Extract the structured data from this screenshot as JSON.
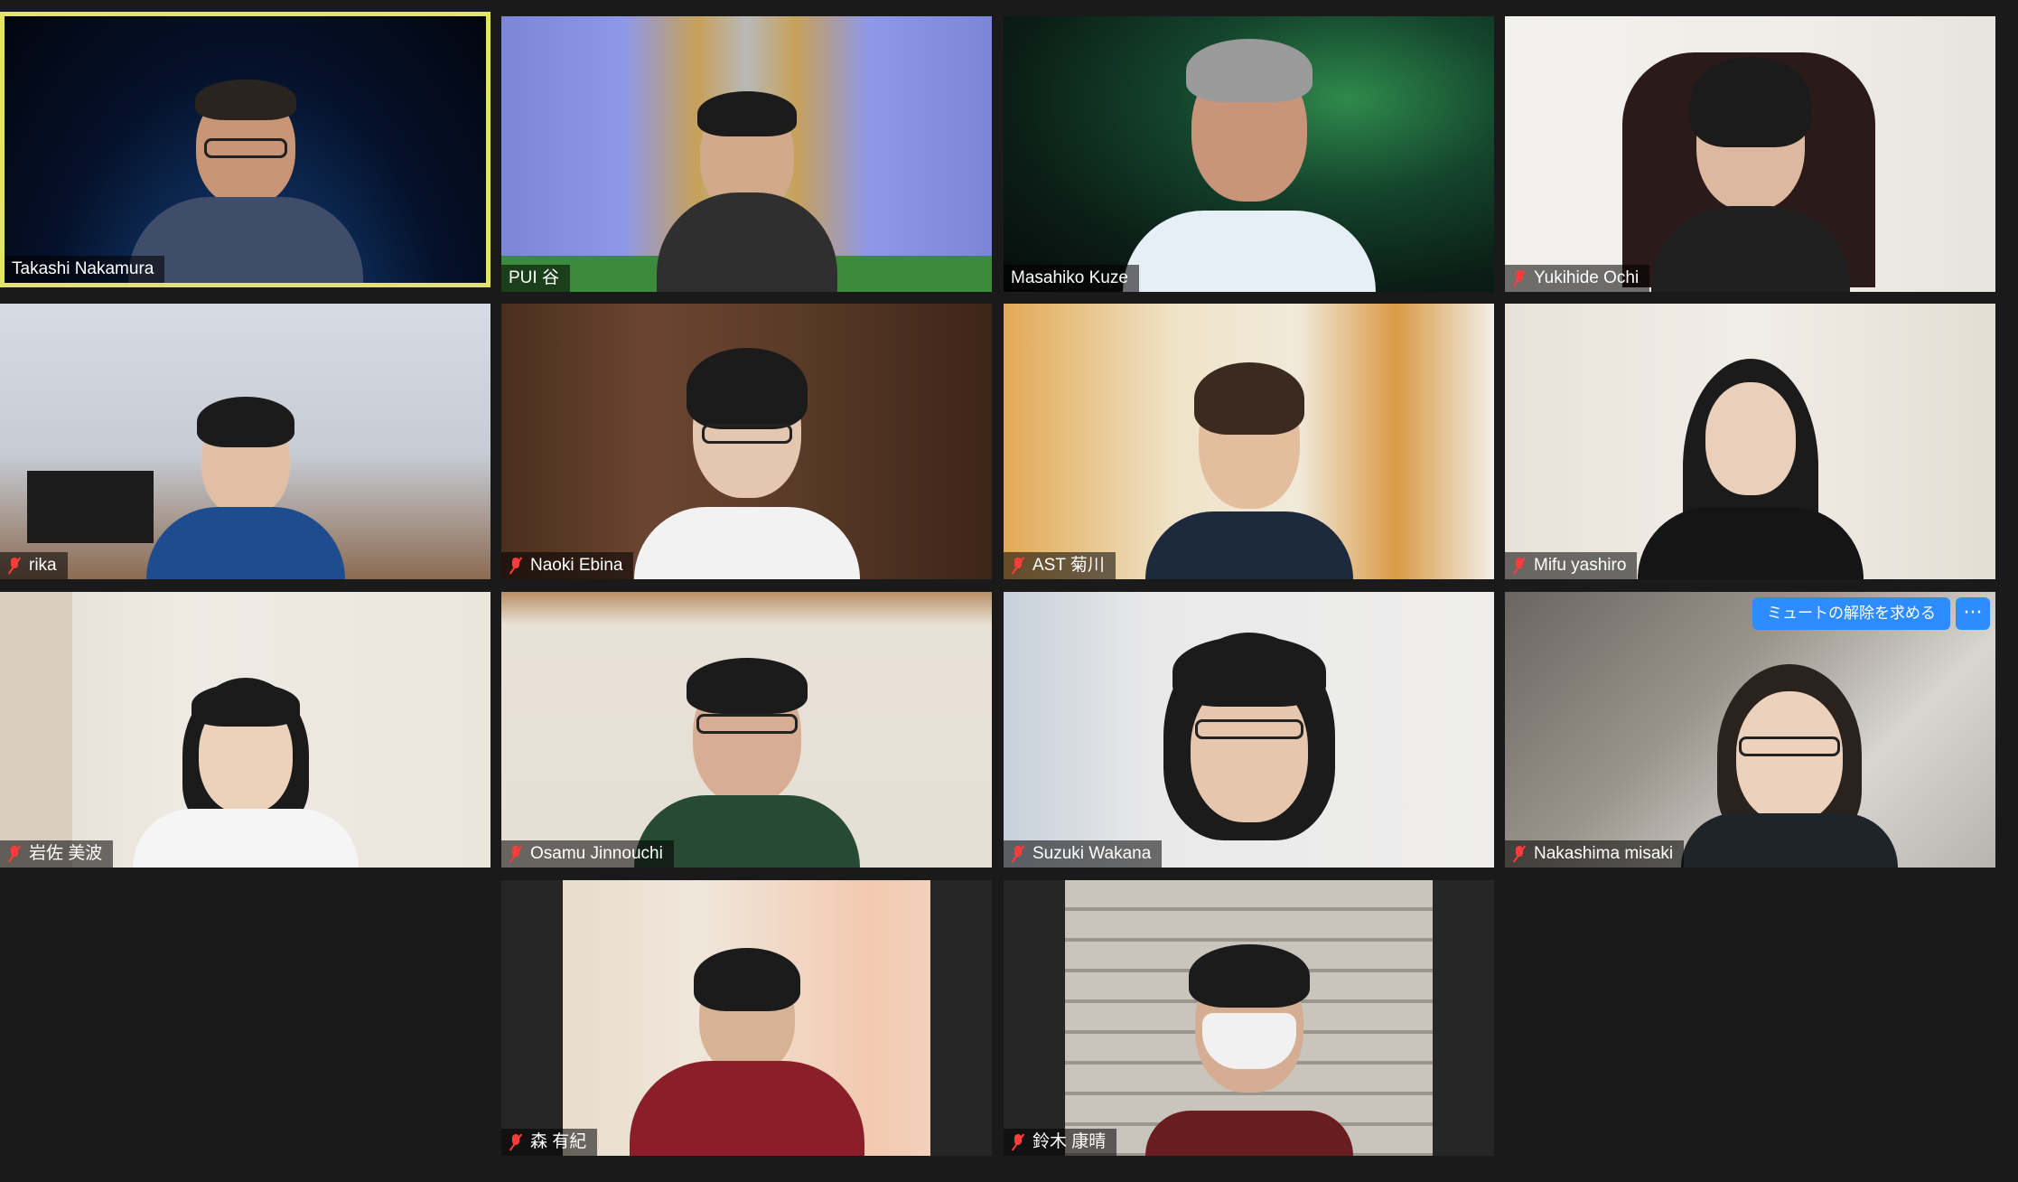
{
  "app": {
    "view": "gallery"
  },
  "unmute_request": {
    "button_label": "ミュートの解除を求める",
    "more_label": "···"
  },
  "participants": [
    {
      "name": "Takashi Nakamura",
      "muted": false,
      "active_speaker": true,
      "background": "earth-space"
    },
    {
      "name": "PUI 谷",
      "muted": false,
      "active_speaker": false,
      "background": "particle-detector"
    },
    {
      "name": "Masahiko Kuze",
      "muted": false,
      "active_speaker": false,
      "background": "aurora"
    },
    {
      "name": "Yukihide Ochi",
      "muted": true,
      "active_speaker": false,
      "background": "room"
    },
    {
      "name": "rika",
      "muted": true,
      "active_speaker": false,
      "background": "room"
    },
    {
      "name": "Naoki Ebina",
      "muted": true,
      "active_speaker": false,
      "background": "room"
    },
    {
      "name": "AST 菊川",
      "muted": true,
      "active_speaker": false,
      "background": "room"
    },
    {
      "name": "Mifu yashiro",
      "muted": true,
      "active_speaker": false,
      "background": "room"
    },
    {
      "name": "岩佐 美波",
      "muted": true,
      "active_speaker": false,
      "background": "room"
    },
    {
      "name": "Osamu Jinnouchi",
      "muted": true,
      "active_speaker": false,
      "background": "room"
    },
    {
      "name": "Suzuki Wakana",
      "muted": true,
      "active_speaker": false,
      "background": "room"
    },
    {
      "name": "Nakashima misaki",
      "muted": true,
      "active_speaker": false,
      "background": "car"
    },
    {
      "name": "森 有紀",
      "muted": true,
      "active_speaker": false,
      "background": "room"
    },
    {
      "name": "鈴木 康晴",
      "muted": true,
      "active_speaker": false,
      "background": "room"
    }
  ]
}
